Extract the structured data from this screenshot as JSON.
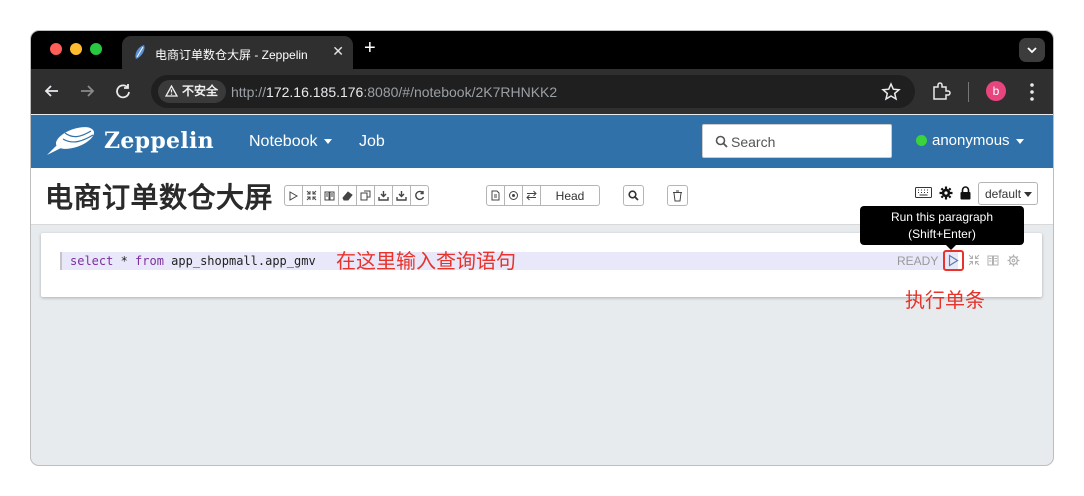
{
  "browser": {
    "tab_title": "电商订单数仓大屏 - Zeppelin",
    "tab_close": "✕",
    "new_tab": "+",
    "security_label": "不安全",
    "url_scheme": "http://",
    "url_host": "172.16.185.176",
    "url_rest": ":8080/#/notebook/2K7RHNKK2",
    "profile_initial": "b"
  },
  "zeppelin": {
    "brand": "Zeppelin",
    "nav": {
      "notebook": "Notebook",
      "job": "Job"
    },
    "search_placeholder": "Search",
    "user": "anonymous",
    "user_status_color": "#3bd33b"
  },
  "notebook": {
    "title": "电商订单数仓大屏",
    "head_label": "Head",
    "interpreter_default": "default"
  },
  "paragraph": {
    "code": {
      "kw1": "select",
      "star": " * ",
      "kw2": "from",
      "table": " app_shopmall.app_gmv"
    },
    "status": "READY",
    "tooltip_line1": "Run this paragraph",
    "tooltip_line2": "(Shift+Enter)"
  },
  "annotations": {
    "input_hint": "在这里输入查询语句",
    "run_hint": "执行单条",
    "color": "#e8332a"
  },
  "colors": {
    "header": "#3071a9",
    "chrome_dark": "#000000"
  }
}
